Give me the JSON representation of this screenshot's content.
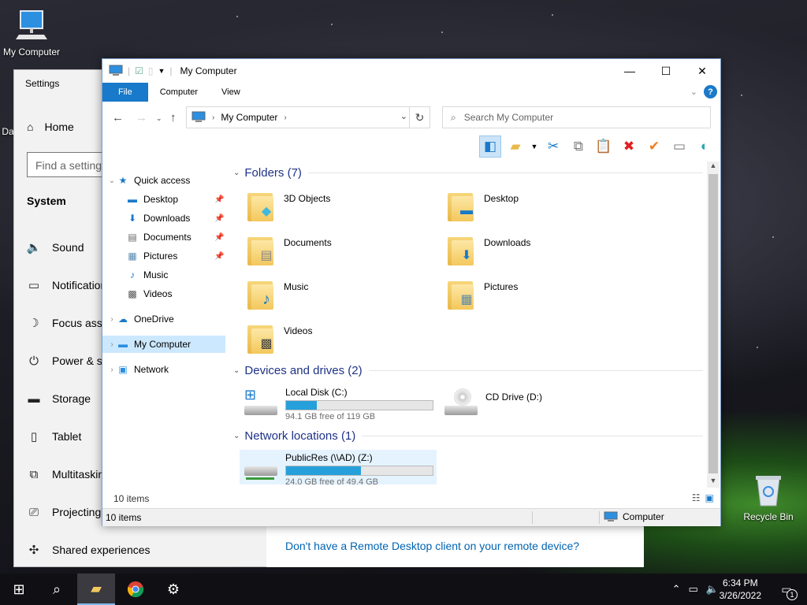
{
  "desktop": {
    "my_computer_label": "My Computer",
    "recycle_bin_label": "Recycle Bin",
    "partial_label": "Da"
  },
  "settings": {
    "title": "Settings",
    "home": "Home",
    "search_placeholder": "Find a setting",
    "section": "System",
    "items": [
      {
        "label": "Sound",
        "icon": "speaker-icon"
      },
      {
        "label": "Notifications & actions",
        "icon": "notification-icon"
      },
      {
        "label": "Focus assist",
        "icon": "moon-icon"
      },
      {
        "label": "Power & sleep",
        "icon": "power-icon"
      },
      {
        "label": "Storage",
        "icon": "storage-icon"
      },
      {
        "label": "Tablet",
        "icon": "tablet-icon"
      },
      {
        "label": "Multitasking",
        "icon": "multitasking-icon"
      },
      {
        "label": "Projecting to this PC",
        "icon": "projecting-icon"
      },
      {
        "label": "Shared experiences",
        "icon": "shared-icon"
      }
    ],
    "remote_link": "Don't have a Remote Desktop client on your remote device?"
  },
  "explorer": {
    "title": "My Computer",
    "tabs": {
      "file": "File",
      "computer": "Computer",
      "view": "View"
    },
    "address": "My Computer",
    "search_placeholder": "Search My Computer",
    "nav": {
      "quick_access": "Quick access",
      "desktop": "Desktop",
      "downloads": "Downloads",
      "documents": "Documents",
      "pictures": "Pictures",
      "music": "Music",
      "videos": "Videos",
      "onedrive": "OneDrive",
      "my_computer": "My Computer",
      "network": "Network"
    },
    "groups": {
      "folders": "Folders (7)",
      "devices": "Devices and drives (2)",
      "network": "Network locations (1)"
    },
    "folders": [
      {
        "name": "3D Objects",
        "icon": "cube-icon"
      },
      {
        "name": "Desktop",
        "icon": "monitor-icon"
      },
      {
        "name": "Documents",
        "icon": "document-icon"
      },
      {
        "name": "Downloads",
        "icon": "download-arrow-icon"
      },
      {
        "name": "Music",
        "icon": "music-note-icon"
      },
      {
        "name": "Pictures",
        "icon": "landscape-icon"
      },
      {
        "name": "Videos",
        "icon": "film-icon"
      }
    ],
    "drives": [
      {
        "name": "Local Disk (C:)",
        "free": "94.1 GB free of 119 GB",
        "used_fraction": 0.21
      },
      {
        "name": "CD Drive (D:)"
      }
    ],
    "network_locations": [
      {
        "name": "PublicRes (\\\\AD) (Z:)",
        "free": "24.0 GB free of 49.4 GB",
        "used_fraction": 0.51
      }
    ],
    "status_items": "10 items",
    "statusbar_items": "10 items",
    "statusbar_location": "Computer",
    "colors": {
      "accent": "#1979ca",
      "bar_fill": "#26a0da",
      "selection": "#cce8ff"
    }
  },
  "taskbar": {
    "time": "6:34 PM",
    "date": "3/26/2022",
    "notification_count": "1"
  }
}
